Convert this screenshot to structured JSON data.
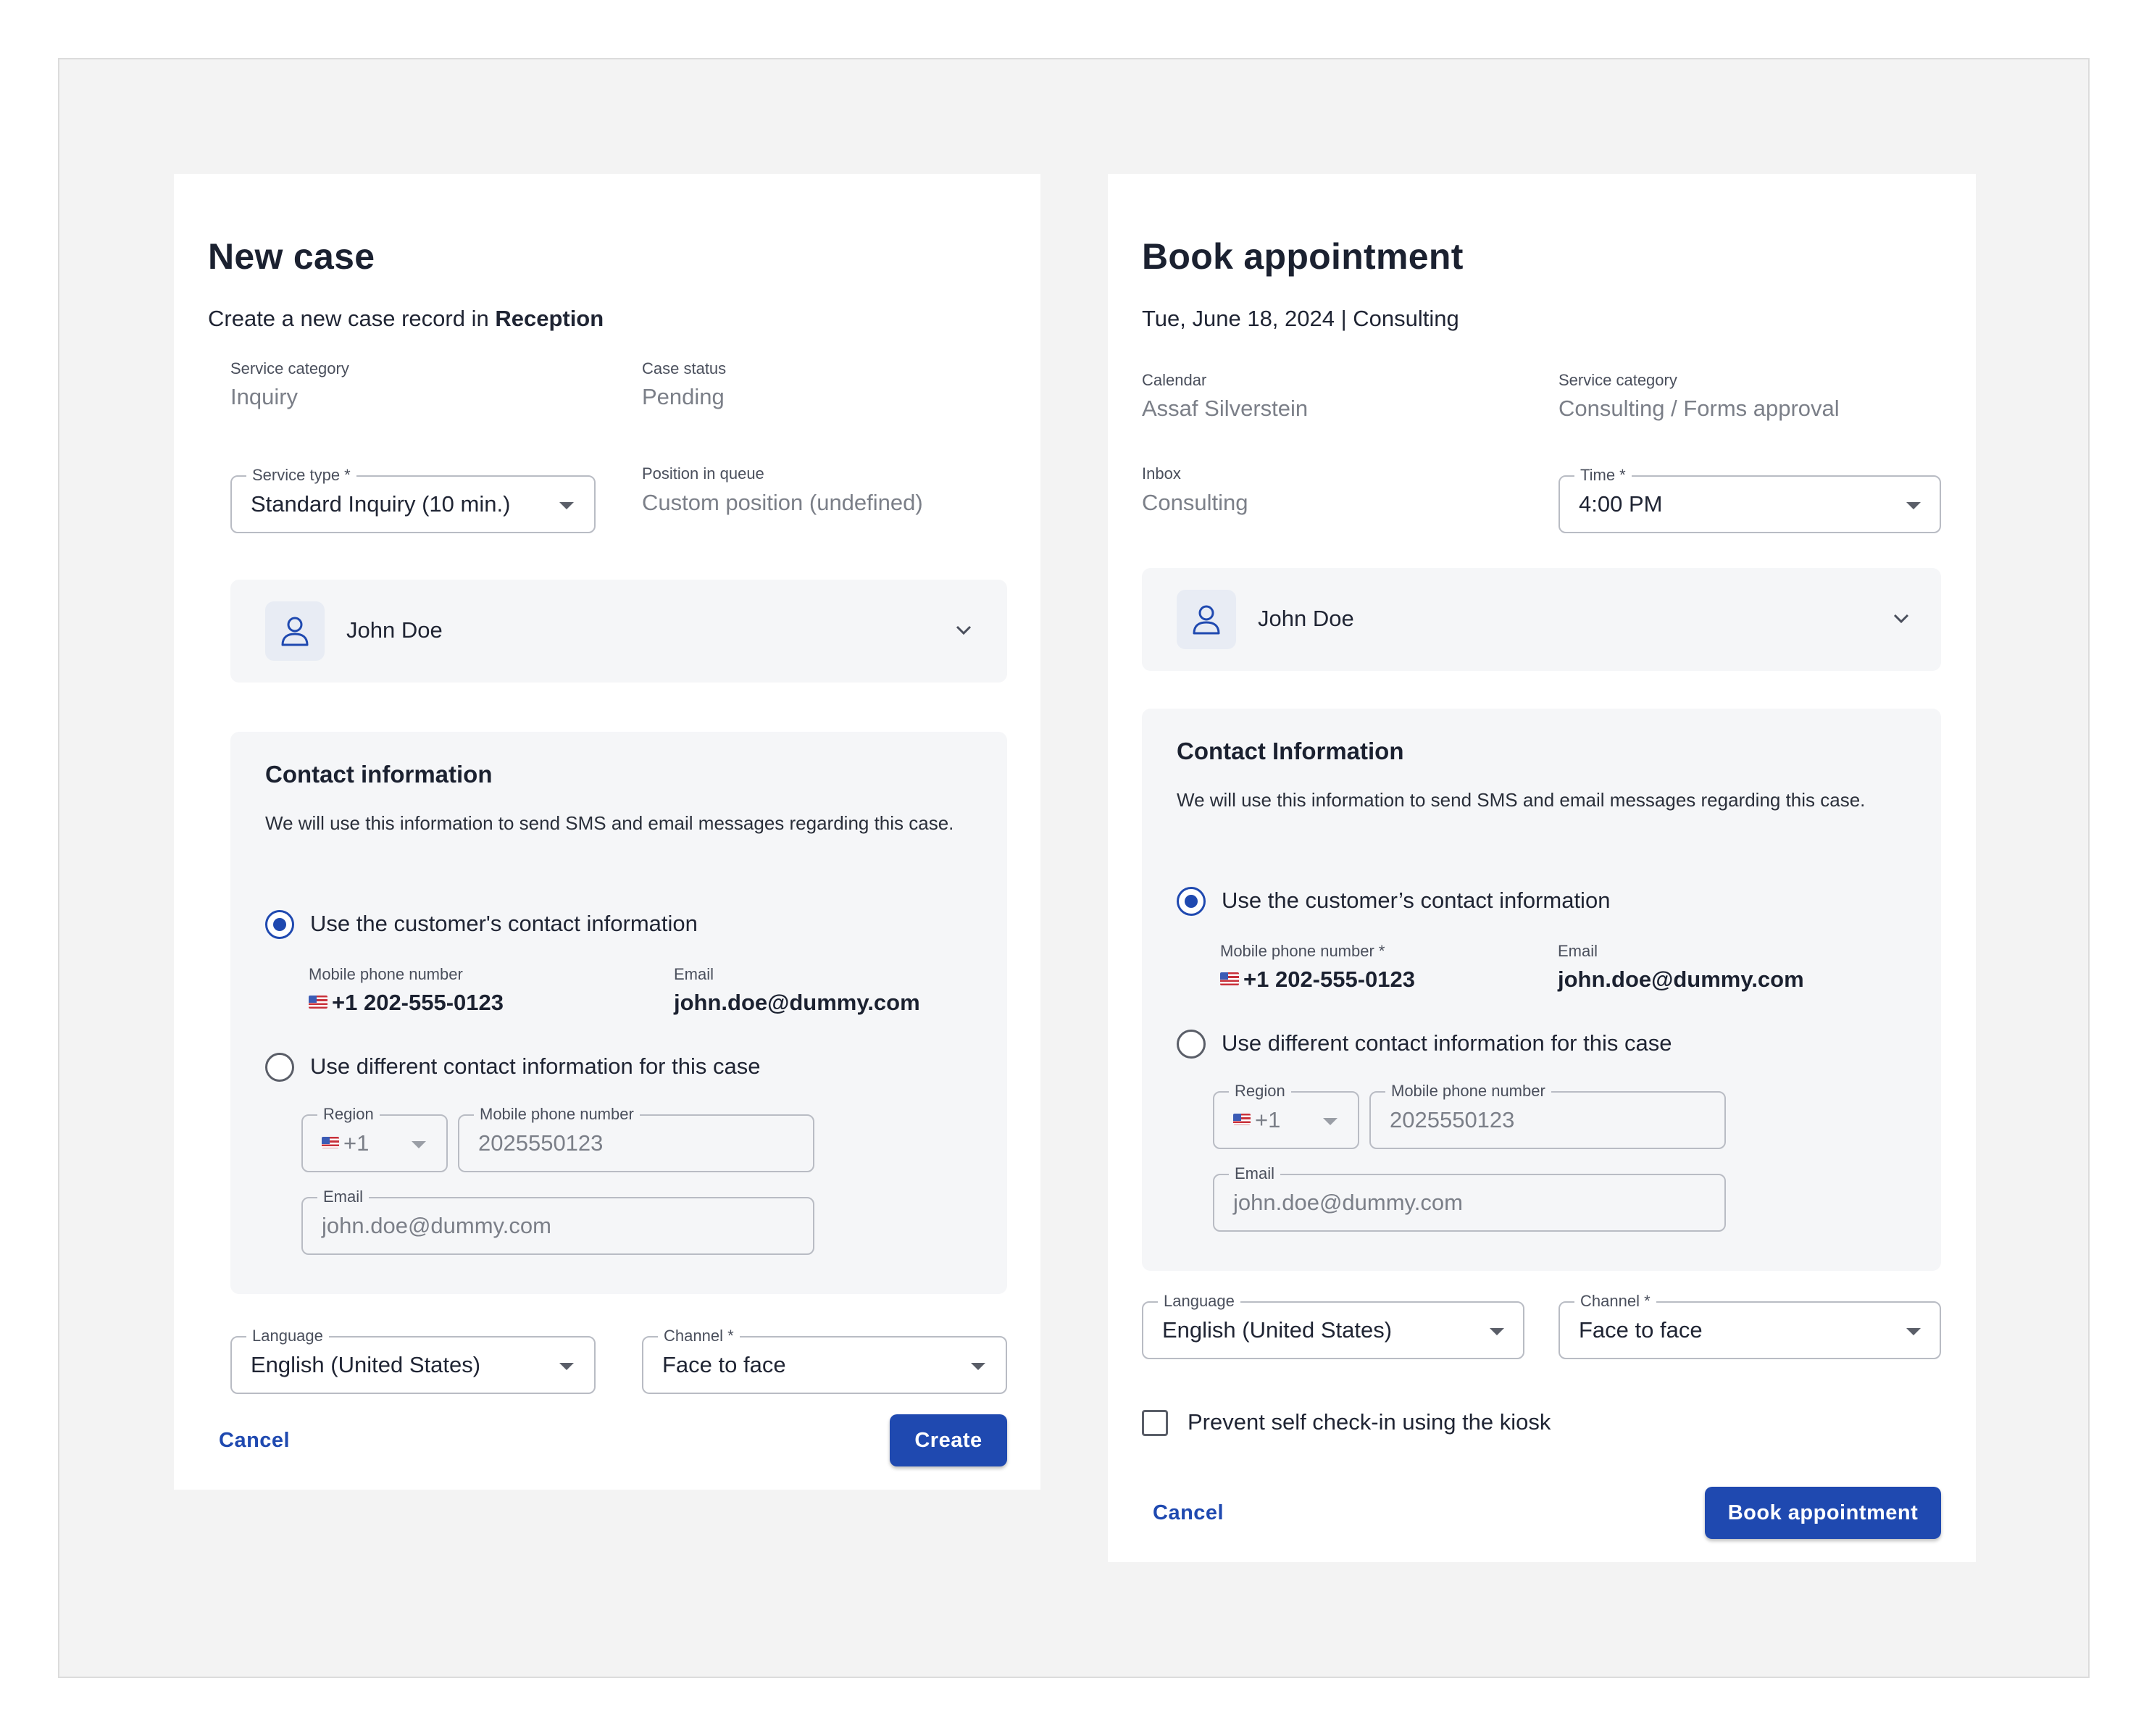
{
  "new_case": {
    "title": "New case",
    "subtitle_prefix": "Create a new case record in",
    "subtitle_bold": "Reception",
    "service_category": {
      "label": "Service category",
      "value": "Inquiry"
    },
    "case_status": {
      "label": "Case status",
      "value": "Pending"
    },
    "service_type": {
      "label": "Service type *",
      "value": "Standard Inquiry (10 min.)"
    },
    "position_in_queue": {
      "label": "Position in queue",
      "value": "Custom position (undefined)"
    },
    "customer_name": "John Doe",
    "contact": {
      "title": "Contact information",
      "description": "We will use this information to send SMS and email messages regarding this case.",
      "option_customer": "Use the customer's contact information",
      "mobile_label": "Mobile phone number",
      "mobile_value": "+1 202-555-0123",
      "email_label": "Email",
      "email_value": "john.doe@dummy.com",
      "option_different": "Use different contact information for this case",
      "region_label": "Region",
      "region_value": "+1",
      "mobile_field_label": "Mobile phone number",
      "mobile_field_placeholder": "2025550123",
      "email_field_label": "Email",
      "email_field_placeholder": "john.doe@dummy.com",
      "selected": "customer"
    },
    "language": {
      "label": "Language",
      "value": "English (United States)"
    },
    "channel": {
      "label": "Channel *",
      "value": "Face to face"
    },
    "cancel_label": "Cancel",
    "create_label": "Create"
  },
  "book_appointment": {
    "title": "Book appointment",
    "subtitle": "Tue, June 18, 2024 | Consulting",
    "calendar": {
      "label": "Calendar",
      "value": "Assaf Silverstein"
    },
    "service_category": {
      "label": "Service category",
      "value": "Consulting / Forms approval"
    },
    "inbox": {
      "label": "Inbox",
      "value": "Consulting"
    },
    "time": {
      "label": "Time *",
      "value": "4:00 PM"
    },
    "customer_name": "John Doe",
    "contact": {
      "title": "Contact Information",
      "description": "We will use this information to send SMS and email messages regarding this case.",
      "option_customer": "Use the customer’s contact information",
      "mobile_label": "Mobile phone number *",
      "mobile_value": "+1 202-555-0123",
      "email_label": "Email",
      "email_value": "john.doe@dummy.com",
      "option_different": "Use different contact information for this case",
      "region_label": "Region",
      "region_value": "+1",
      "mobile_field_label": "Mobile phone number",
      "mobile_field_placeholder": "2025550123",
      "email_field_label": "Email",
      "email_field_placeholder": "john.doe@dummy.com",
      "selected": "customer"
    },
    "language": {
      "label": "Language",
      "value": "English (United States)"
    },
    "channel": {
      "label": "Channel *",
      "value": "Face to face"
    },
    "kiosk_checkbox_label": "Prevent self check-in using the kiosk",
    "kiosk_checked": false,
    "cancel_label": "Cancel",
    "book_label": "Book appointment"
  },
  "colors": {
    "accent": "#1f49b0",
    "panel_bg": "#f5f6f8",
    "frame_bg": "#f3f3f3"
  }
}
